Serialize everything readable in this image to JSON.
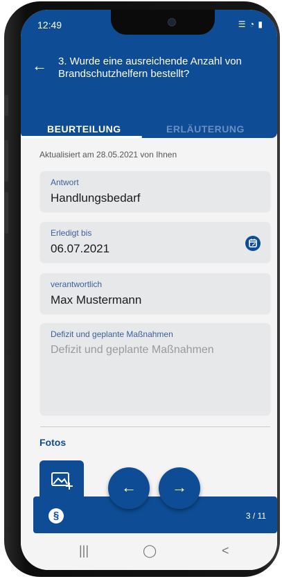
{
  "status": {
    "time": "12:49",
    "left_icons": "♥ ✿ ▫",
    "right_icons": "☰ ◔ ▮"
  },
  "header": {
    "back_icon": "arrow-left-icon",
    "title": "3. Wurde eine ausreichende Anzahl von Brandschutzhelfern bestellt?",
    "tabs": [
      {
        "label": "BEURTEILUNG",
        "active": true
      },
      {
        "label": "ERLÄUTERUNG",
        "active": false
      }
    ]
  },
  "main": {
    "updated": "Aktualisiert am 28.05.2021 von Ihnen",
    "fields": {
      "antwort": {
        "label": "Antwort",
        "value": "Handlungsbedarf"
      },
      "erledigt": {
        "label": "Erledigt bis",
        "value": "06.07.2021"
      },
      "verantwortlich": {
        "label": "verantwortlich",
        "value": "Max Mustermann"
      },
      "defizit": {
        "label": "Defizit und geplante Maßnahmen",
        "placeholder": "Defizit und geplante Maßnahmen"
      }
    },
    "fotos_label": "Fotos"
  },
  "footer": {
    "paragraph_symbol": "§",
    "pager": "3 / 11",
    "prev_icon": "←",
    "next_icon": "→"
  },
  "system_nav": {
    "recents": "|||",
    "home": "◯",
    "back": "<"
  },
  "colors": {
    "primary": "#0e4d95",
    "inactive_tab": "#6a8fc0",
    "label": "#3b5f9a",
    "field_bg": "#e6e8ea"
  }
}
